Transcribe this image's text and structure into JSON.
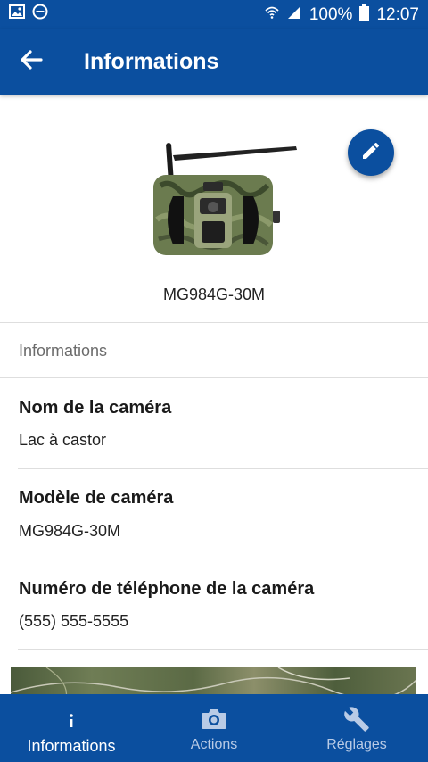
{
  "status_bar": {
    "battery": "100%",
    "time": "12:07"
  },
  "app_bar": {
    "title": "Informations"
  },
  "camera": {
    "model_caption": "MG984G-30M"
  },
  "info_section": {
    "header": "Informations",
    "fields": [
      {
        "label": "Nom de la caméra",
        "value": "Lac à castor"
      },
      {
        "label": "Modèle de caméra",
        "value": "MG984G-30M"
      },
      {
        "label": "Numéro de téléphone de la caméra",
        "value": "(555) 555-5555"
      }
    ]
  },
  "bottom_nav": {
    "items": [
      {
        "label": "Informations",
        "icon": "info-icon",
        "active": true
      },
      {
        "label": "Actions",
        "icon": "camera-icon",
        "active": false
      },
      {
        "label": "Réglages",
        "icon": "wrench-icon",
        "active": false
      }
    ]
  },
  "colors": {
    "primary": "#0b4f9f",
    "nav_inactive": "#b9cbe6",
    "divider": "#dedede"
  }
}
